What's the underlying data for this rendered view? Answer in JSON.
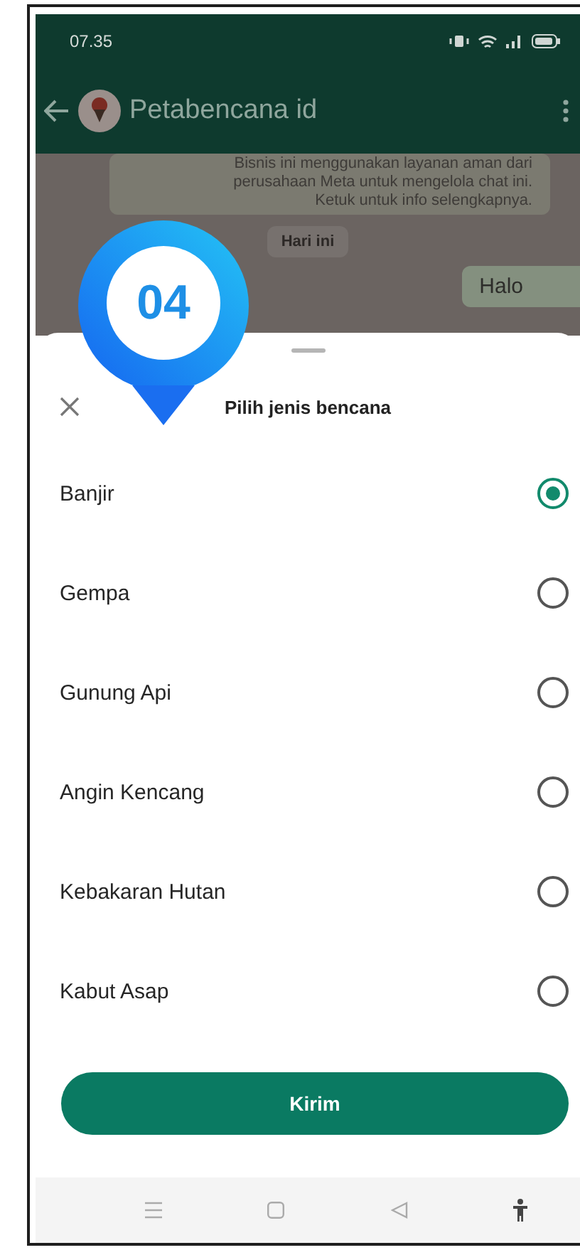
{
  "status_bar": {
    "time": "07.35"
  },
  "header": {
    "title": "Petabencana id"
  },
  "chat": {
    "banner_lines": [
      "Bisnis ini menggunakan layanan aman dari",
      "perusahaan Meta untuk mengelola chat ini.",
      "Ketuk untuk info selengkapnya."
    ],
    "date_chip": "Hari ini",
    "messages": [
      {
        "text": "Halo"
      }
    ]
  },
  "sheet": {
    "title": "Pilih jenis bencana",
    "options": [
      {
        "label": "Banjir",
        "selected": true
      },
      {
        "label": "Gempa",
        "selected": false
      },
      {
        "label": "Gunung Api",
        "selected": false
      },
      {
        "label": "Angin Kencang",
        "selected": false
      },
      {
        "label": "Kebakaran Hutan",
        "selected": false
      },
      {
        "label": "Kabut Asap",
        "selected": false
      }
    ],
    "submit": "Kirim"
  },
  "annotation": {
    "number": "04"
  }
}
